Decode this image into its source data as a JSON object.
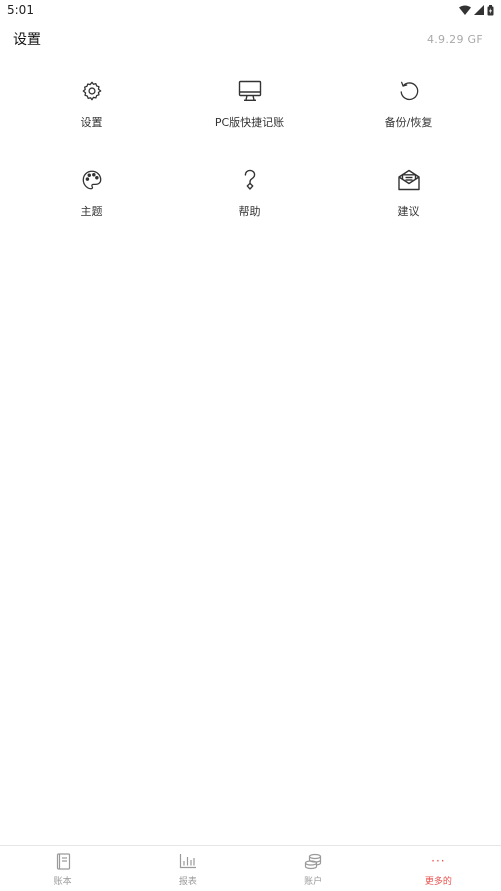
{
  "status_bar": {
    "time": "5:01",
    "icons": [
      "wifi-icon",
      "signal-icon",
      "battery-icon"
    ]
  },
  "header": {
    "title": "设置",
    "version": "4.9.29 GF"
  },
  "grid": {
    "items": [
      {
        "label": "设置",
        "icon": "gear-icon"
      },
      {
        "label": "PC版快捷记账",
        "icon": "monitor-icon"
      },
      {
        "label": "备份/恢复",
        "icon": "restore-icon"
      },
      {
        "label": "主题",
        "icon": "palette-icon"
      },
      {
        "label": "帮助",
        "icon": "help-icon"
      },
      {
        "label": "建议",
        "icon": "mail-icon"
      }
    ]
  },
  "bottom_nav": {
    "items": [
      {
        "label": "账本",
        "icon": "book-icon"
      },
      {
        "label": "报表",
        "icon": "chart-icon"
      },
      {
        "label": "账户",
        "icon": "coins-icon"
      },
      {
        "label": "更多的",
        "icon": "more-icon",
        "active": true,
        "glyph": "···"
      }
    ]
  },
  "colors": {
    "accent": "#e8504e",
    "text": "#333333",
    "muted": "#9a9a9a",
    "version": "#a9a9a9"
  }
}
